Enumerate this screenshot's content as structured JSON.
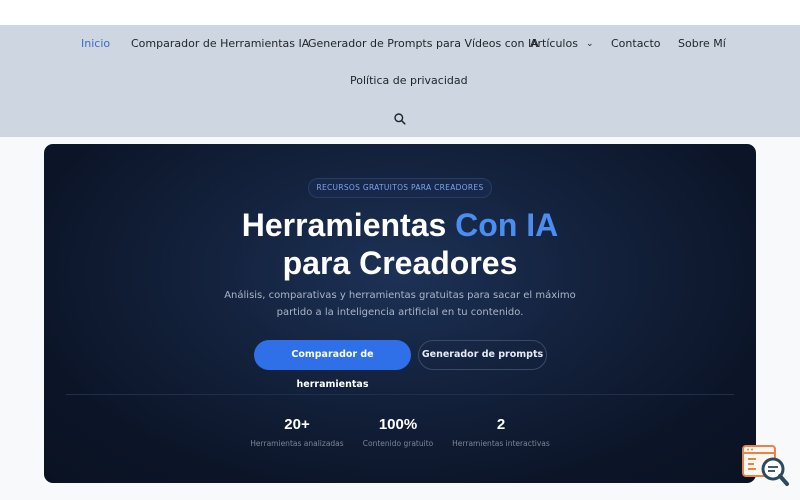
{
  "nav": {
    "items": [
      {
        "label": "Inicio",
        "active": true
      },
      {
        "label": "Comparador de Herramientas IA"
      },
      {
        "label": "Generador de Prompts para Vídeos con IA"
      },
      {
        "label": "Artículos",
        "dropdown": true
      },
      {
        "label": "Contacto"
      },
      {
        "label": "Sobre Mí"
      },
      {
        "label": "Política de privacidad"
      }
    ],
    "search_icon": "search-icon",
    "dropdown_icon": "⌄"
  },
  "hero": {
    "badge": "RECURSOS GRATUITOS PARA CREADORES",
    "title_part1": "Herramientas ",
    "title_accent": "Con IA",
    "title_line2": "para Creadores",
    "subtitle_line1": "Análisis, comparativas y herramientas gratuitas para sacar el máximo",
    "subtitle_line2": "partido a la inteligencia artificial en tu contenido.",
    "primary_button": "Comparador de herramientas",
    "secondary_button": "Generador de prompts",
    "stats": [
      {
        "value": "20+",
        "label": "Herramientas analizadas"
      },
      {
        "value": "100%",
        "label": "Contenido gratuito"
      },
      {
        "value": "2",
        "label": "Herramientas interactivas"
      }
    ]
  },
  "colors": {
    "nav_bg": "#cdd6e1",
    "accent": "#4b8ef0",
    "primary_button": "#2f6fe8",
    "hero_bg": "#0c1528"
  },
  "widget_icon": "chat-search-icon"
}
